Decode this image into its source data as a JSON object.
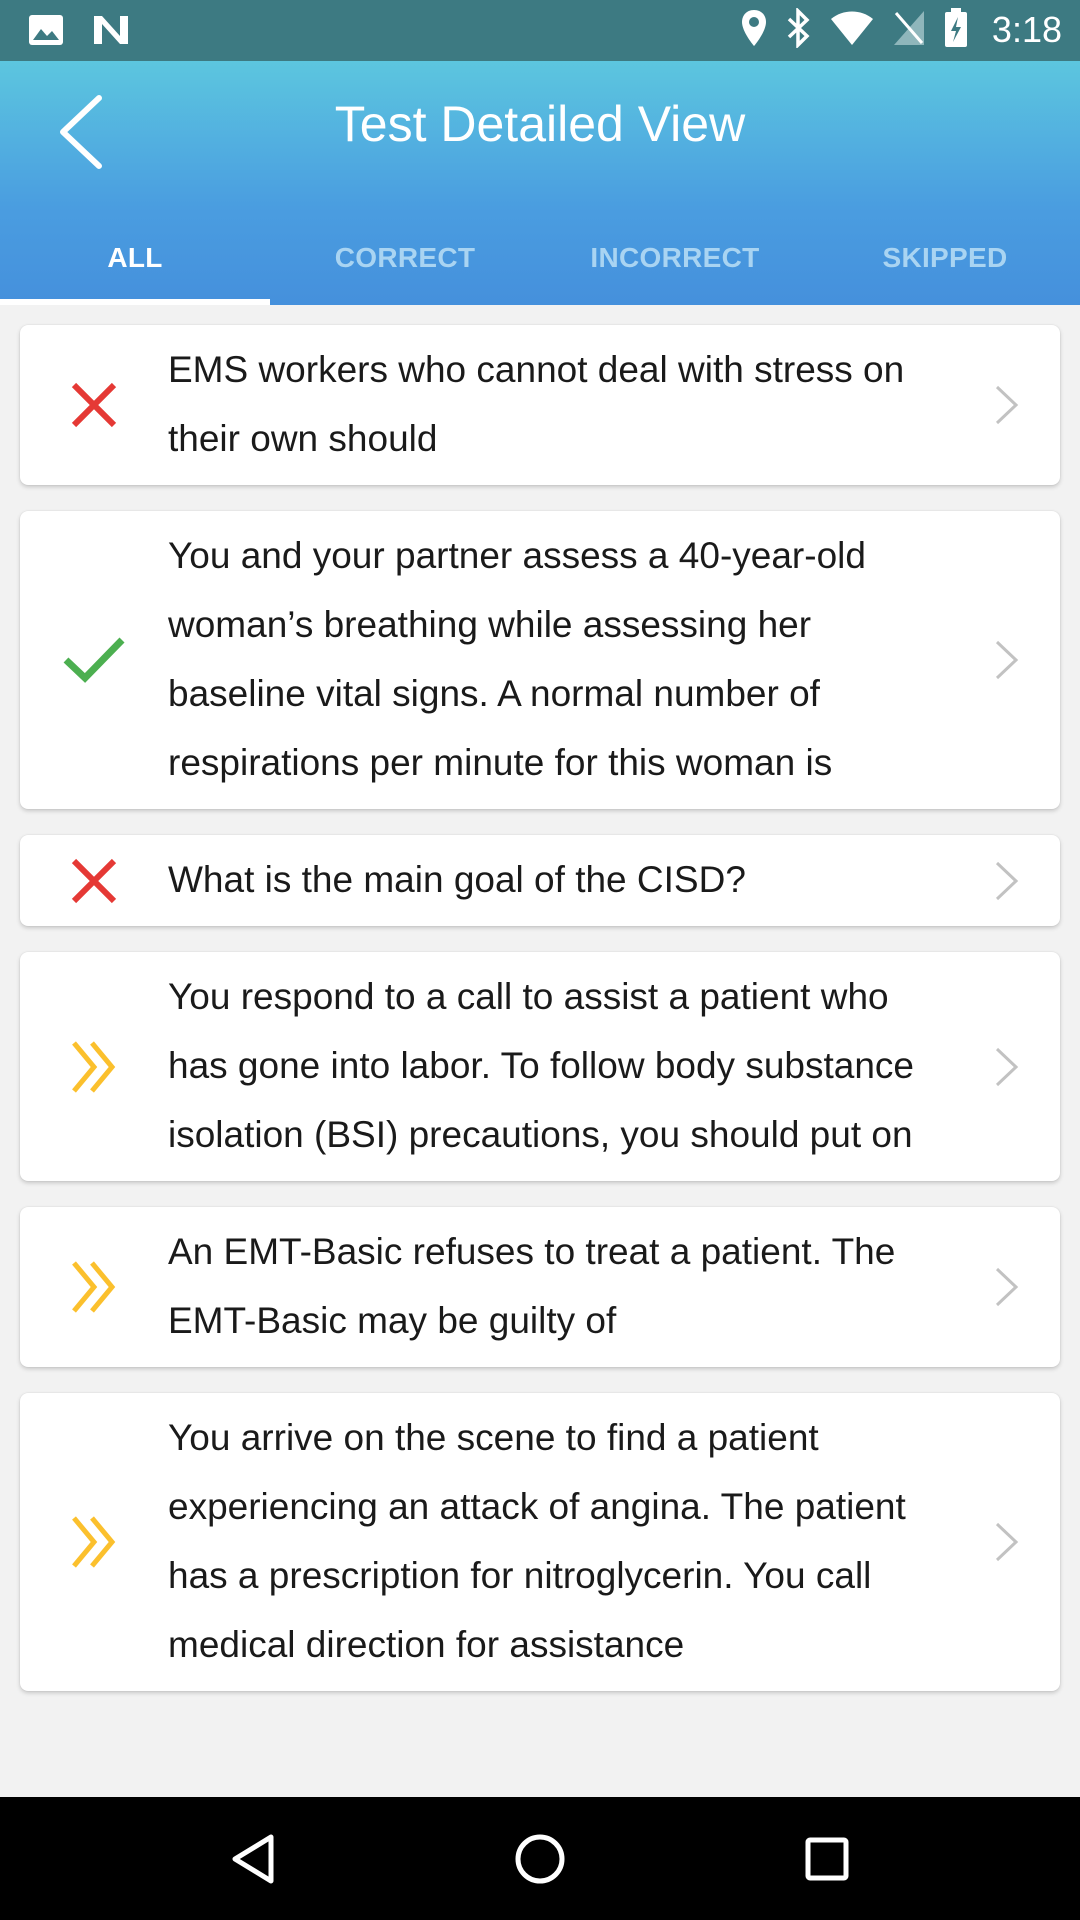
{
  "status_bar": {
    "time": "3:18",
    "icons": [
      "image-icon",
      "n-notification-icon",
      "location-icon",
      "bluetooth-icon",
      "wifi-icon",
      "no-signal-icon",
      "battery-charging-icon"
    ]
  },
  "header": {
    "title": "Test Detailed View",
    "back_icon": "chevron-left-icon"
  },
  "tabs": [
    {
      "label": "ALL",
      "active": true
    },
    {
      "label": "CORRECT",
      "active": false
    },
    {
      "label": "INCORRECT",
      "active": false
    },
    {
      "label": "SKIPPED",
      "active": false
    }
  ],
  "colors": {
    "incorrect": "#e53935",
    "correct": "#4caf50",
    "skipped": "#fbc02d",
    "tab_active": "#ffffff",
    "tab_inactive": "#a9d4f2"
  },
  "questions": [
    {
      "status": "incorrect",
      "text": "EMS workers who cannot deal with stress on their own should"
    },
    {
      "status": "correct",
      "text": "You and your partner assess a 40-year-old woman’s breathing while assessing her baseline vital signs. A normal number of respirations per minute for this woman is"
    },
    {
      "status": "incorrect",
      "text": "What is the main goal of the CISD?"
    },
    {
      "status": "skipped",
      "text": "You respond to a call to assist a patient who has gone into labor. To follow body substance isolation (BSI) precautions, you should put on"
    },
    {
      "status": "skipped",
      "text": "An EMT-Basic refuses to treat a patient. The EMT-Basic may be guilty of"
    },
    {
      "status": "skipped",
      "text": "You arrive on the scene to find a patient experiencing an attack of angina. The patient has a prescription for nitroglycerin. You call medical direction for assistance"
    }
  ],
  "nav_bar": {
    "buttons": [
      "back-triangle-icon",
      "home-circle-icon",
      "recents-square-icon"
    ]
  }
}
